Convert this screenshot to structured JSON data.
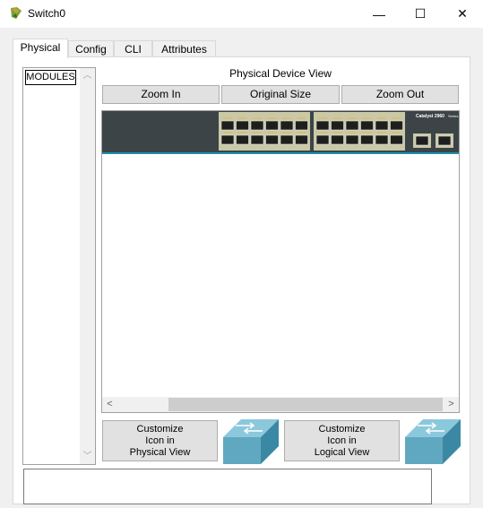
{
  "window": {
    "title": "Switch0",
    "minimize_glyph": "—",
    "maximize_glyph": "☐",
    "close_glyph": "✕",
    "app_icon": "packet-tracer-device-icon"
  },
  "tabs": [
    {
      "label": "Physical",
      "active": true
    },
    {
      "label": "Config",
      "active": false
    },
    {
      "label": "CLI",
      "active": false
    },
    {
      "label": "Attributes",
      "active": false
    }
  ],
  "modules": {
    "label": "MODULES"
  },
  "physical_view": {
    "title": "Physical Device View",
    "zoom_in": "Zoom In",
    "original_size": "Original Size",
    "zoom_out": "Zoom Out",
    "device_model_text": "Catalyst 2960",
    "device_series_text": "Series"
  },
  "customize": {
    "physical_line1": "Customize",
    "physical_line2": "Icon in",
    "physical_line3": "Physical View",
    "logical_line1": "Customize",
    "logical_line2": "Icon in",
    "logical_line3": "Logical View"
  },
  "colors": {
    "device_body": "#3c4447",
    "device_accent": "#1c8fb0",
    "switch_icon": "#5fa8c0"
  }
}
